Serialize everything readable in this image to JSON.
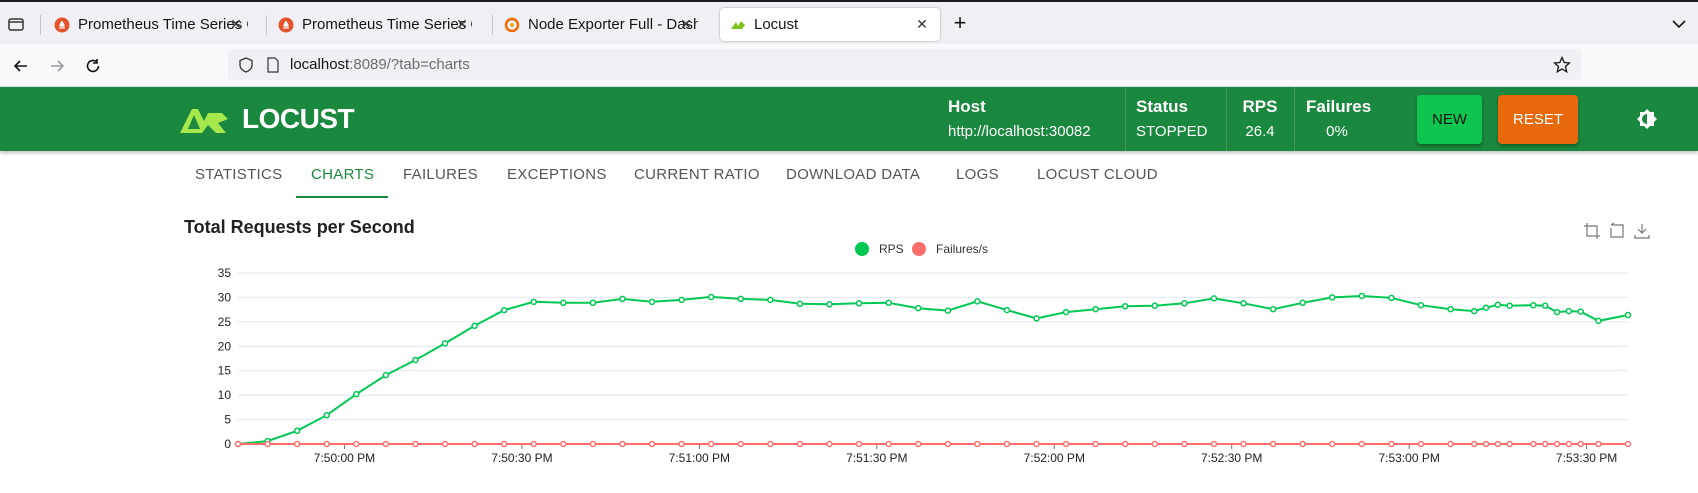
{
  "browser": {
    "tabs": [
      {
        "title": "Prometheus Time Series C",
        "active": false
      },
      {
        "title": "Prometheus Time Series C",
        "active": false
      },
      {
        "title": "Node Exporter Full - Dash",
        "active": false
      },
      {
        "title": "Locust",
        "active": true
      }
    ],
    "url": {
      "host": "localhost",
      "rest": ":8089/?tab=charts"
    }
  },
  "header": {
    "logo_text": "LOCUST",
    "host_label": "Host",
    "host_value": "http://localhost:30082",
    "status_label": "Status",
    "status_value": "STOPPED",
    "rps_label": "RPS",
    "rps_value": "26.4",
    "failures_label": "Failures",
    "failures_value": "0%",
    "new_label": "NEW",
    "reset_label": "RESET"
  },
  "app_tabs": [
    "STATISTICS",
    "CHARTS",
    "FAILURES",
    "EXCEPTIONS",
    "CURRENT RATIO",
    "DOWNLOAD DATA",
    "LOGS",
    "LOCUST CLOUD"
  ],
  "active_tab": "CHARTS",
  "colors": {
    "brand_green": "#1a883e",
    "rps": "#00c853",
    "failures": "#ff6d6d",
    "new_button": "#0dc54f",
    "reset_button": "#e8690b"
  },
  "chart_data": {
    "type": "line",
    "title": "Total Requests per Second",
    "legend_placement": "top-center",
    "grid": true,
    "ylim": [
      0,
      35
    ],
    "y_ticks": [
      0,
      5,
      10,
      15,
      20,
      25,
      30,
      35
    ],
    "x_tick_labels": [
      "7:50:00 PM",
      "7:50:30 PM",
      "7:51:00 PM",
      "7:51:30 PM",
      "7:52:00 PM",
      "7:52:30 PM",
      "7:53:00 PM",
      "7:53:30 PM"
    ],
    "x_tick_times": [
      "7:50:00 PM",
      "7:50:30 PM",
      "7:51:00 PM",
      "7:51:30 PM",
      "7:52:00 PM",
      "7:52:30 PM",
      "7:53:00 PM",
      "7:53:30 PM"
    ],
    "x": [
      "7:49:42 PM",
      "7:49:47 PM",
      "7:49:52 PM",
      "7:49:57 PM",
      "7:50:02 PM",
      "7:50:07 PM",
      "7:50:12 PM",
      "7:50:17 PM",
      "7:50:22 PM",
      "7:50:27 PM",
      "7:50:32 PM",
      "7:50:37 PM",
      "7:50:42 PM",
      "7:50:47 PM",
      "7:50:52 PM",
      "7:50:57 PM",
      "7:51:02 PM",
      "7:51:07 PM",
      "7:51:12 PM",
      "7:51:17 PM",
      "7:51:22 PM",
      "7:51:27 PM",
      "7:51:32 PM",
      "7:51:37 PM",
      "7:51:42 PM",
      "7:51:47 PM",
      "7:51:52 PM",
      "7:51:57 PM",
      "7:52:02 PM",
      "7:52:07 PM",
      "7:52:12 PM",
      "7:52:17 PM",
      "7:52:22 PM",
      "7:52:27 PM",
      "7:52:32 PM",
      "7:52:37 PM",
      "7:52:42 PM",
      "7:52:47 PM",
      "7:52:52 PM",
      "7:52:57 PM",
      "7:53:02 PM",
      "7:53:07 PM",
      "7:53:11 PM",
      "7:53:13 PM",
      "7:53:15 PM",
      "7:53:17 PM",
      "7:53:21 PM",
      "7:53:23 PM",
      "7:53:25 PM",
      "7:53:27 PM",
      "7:53:29 PM",
      "7:53:32 PM",
      "7:53:37 PM"
    ],
    "series": [
      {
        "name": "RPS",
        "color": "#00c853",
        "values": [
          0,
          0.6,
          2.7,
          5.9,
          10.2,
          14.1,
          17.2,
          20.6,
          24.2,
          27.4,
          29.1,
          28.9,
          28.9,
          29.7,
          29.1,
          29.5,
          30.1,
          29.7,
          29.5,
          28.7,
          28.6,
          28.8,
          28.9,
          27.8,
          27.3,
          29.2,
          27.4,
          25.7,
          27.0,
          27.6,
          28.2,
          28.3,
          28.8,
          29.8,
          28.8,
          27.6,
          28.9,
          30.0,
          30.3,
          29.9,
          28.4,
          27.6,
          27.2,
          27.9,
          28.5,
          28.3,
          28.4,
          28.3,
          27.0,
          27.2,
          27.1,
          25.2,
          26.4
        ]
      },
      {
        "name": "Failures/s",
        "color": "#ff6d6d",
        "values": [
          0,
          0,
          0,
          0,
          0,
          0,
          0,
          0,
          0,
          0,
          0,
          0,
          0,
          0,
          0,
          0,
          0,
          0,
          0,
          0,
          0,
          0,
          0,
          0,
          0,
          0,
          0,
          0,
          0,
          0,
          0,
          0,
          0,
          0,
          0,
          0,
          0,
          0,
          0,
          0,
          0,
          0,
          0,
          0,
          0,
          0,
          0,
          0,
          0,
          0,
          0,
          0,
          0
        ]
      }
    ]
  }
}
